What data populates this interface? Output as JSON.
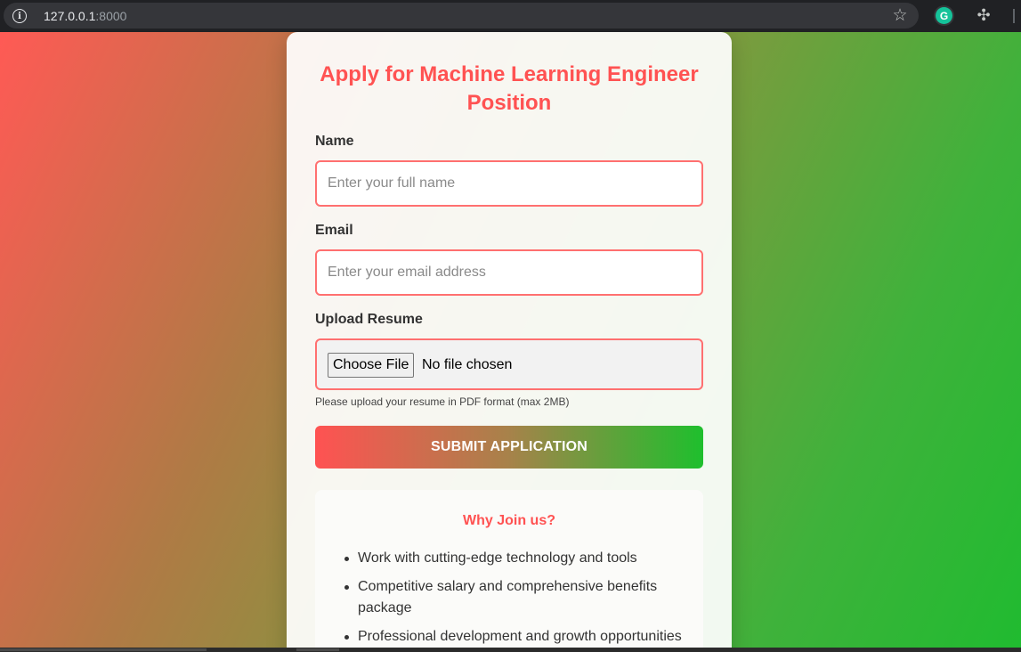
{
  "browser": {
    "url_host": "127.0.0.1",
    "url_port": ":8000",
    "extension_badge": "G"
  },
  "form": {
    "title": "Apply for Machine Learning Engineer Position",
    "name_label": "Name",
    "name_placeholder": "Enter your full name",
    "email_label": "Email",
    "email_placeholder": "Enter your email address",
    "resume_label": "Upload Resume",
    "file_button": "Choose File",
    "file_status": "No file chosen",
    "resume_hint": "Please upload your resume in PDF format (max 2MB)",
    "submit_label": "SUBMIT APPLICATION"
  },
  "why": {
    "title": "Why Join us?",
    "items": [
      "Work with cutting-edge technology and tools",
      "Competitive salary and comprehensive benefits package",
      "Professional development and growth opportunities"
    ]
  },
  "colors": {
    "accent": "#ff5252",
    "border": "#ff7070",
    "gradient_start": "#ff5252",
    "gradient_end": "#1ebf2d"
  }
}
